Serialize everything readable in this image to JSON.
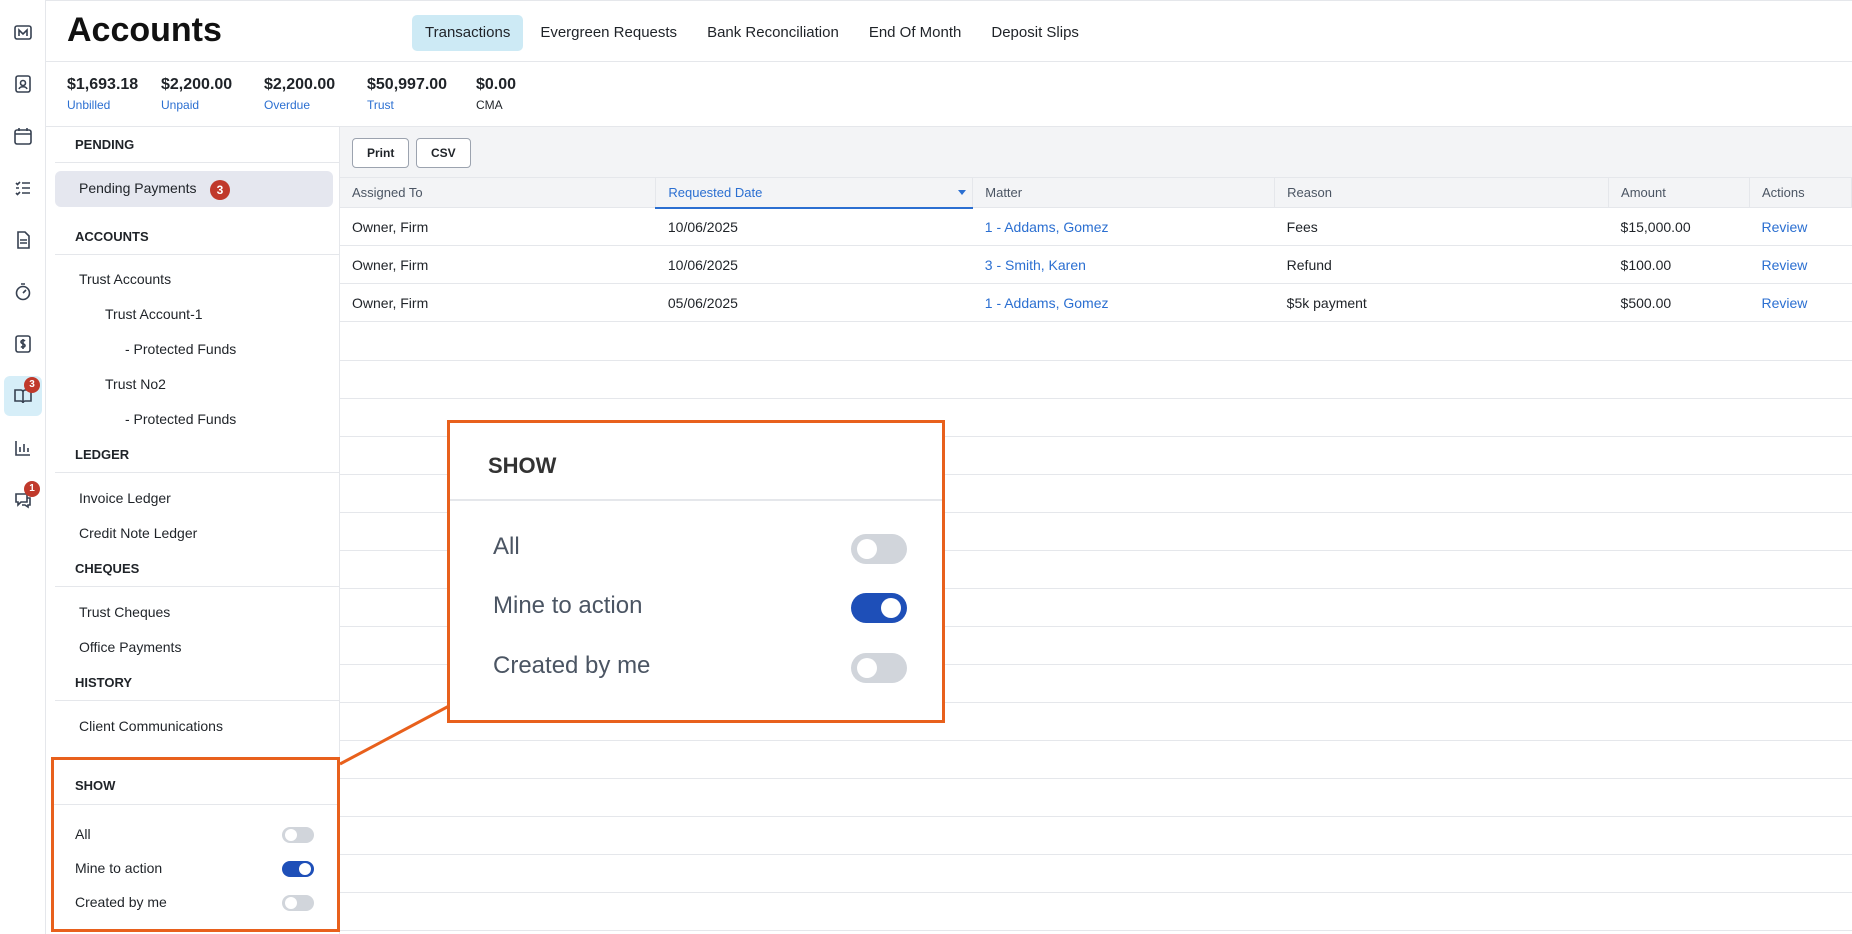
{
  "rail": {
    "icons": [
      "logo-icon",
      "contacts-icon",
      "calendar-icon",
      "tasks-icon",
      "documents-icon",
      "timer-icon",
      "billing-icon",
      "accounts-icon",
      "reports-icon",
      "messages-icon"
    ],
    "accounts_badge": "3",
    "messages_badge": "1"
  },
  "header": {
    "title": "Accounts",
    "tabs": [
      "Transactions",
      "Evergreen Requests",
      "Bank Reconciliation",
      "End Of Month",
      "Deposit Slips"
    ]
  },
  "summary": [
    {
      "value": "$1,693.18",
      "label": "Unbilled"
    },
    {
      "value": "$2,200.00",
      "label": "Unpaid"
    },
    {
      "value": "$2,200.00",
      "label": "Overdue"
    },
    {
      "value": "$50,997.00",
      "label": "Trust"
    },
    {
      "value": "$0.00",
      "label": "CMA"
    }
  ],
  "sidebar": {
    "pending_head": "PENDING",
    "pending_payments": "Pending Payments",
    "pending_count": "3",
    "accounts_head": "ACCOUNTS",
    "trust_accounts": "Trust Accounts",
    "trust_account_1": "Trust Account-1",
    "protected_funds_1": "- Protected Funds",
    "trust_no2": "Trust No2",
    "protected_funds_2": "- Protected Funds",
    "ledger_head": "LEDGER",
    "invoice_ledger": "Invoice Ledger",
    "credit_note_ledger": "Credit Note Ledger",
    "cheques_head": "CHEQUES",
    "trust_cheques": "Trust Cheques",
    "office_payments": "Office Payments",
    "history_head": "HISTORY",
    "client_communications": "Client Communications"
  },
  "show": {
    "head": "SHOW",
    "all": "All",
    "mine": "Mine to action",
    "created": "Created by me",
    "all_on": false,
    "mine_on": true,
    "created_on": false
  },
  "toolbar": {
    "print": "Print",
    "csv": "CSV"
  },
  "table": {
    "columns": [
      "Assigned To",
      "Requested Date",
      "Matter",
      "Reason",
      "Amount",
      "Actions"
    ],
    "rows": [
      [
        "Owner, Firm",
        "10/06/2025",
        "1 - Addams, Gomez",
        "Fees",
        "$15,000.00",
        "Review"
      ],
      [
        "Owner, Firm",
        "10/06/2025",
        "3 - Smith, Karen",
        "Refund",
        "$100.00",
        "Review"
      ],
      [
        "Owner, Firm",
        "05/06/2025",
        "1 - Addams, Gomez",
        "$5k payment",
        "$500.00",
        "Review"
      ]
    ]
  },
  "colors": {
    "accent": "#2b6fd1",
    "highlight_border": "#e8601c",
    "toggle_on": "#1e4fb8",
    "badge": "#c0392b"
  }
}
